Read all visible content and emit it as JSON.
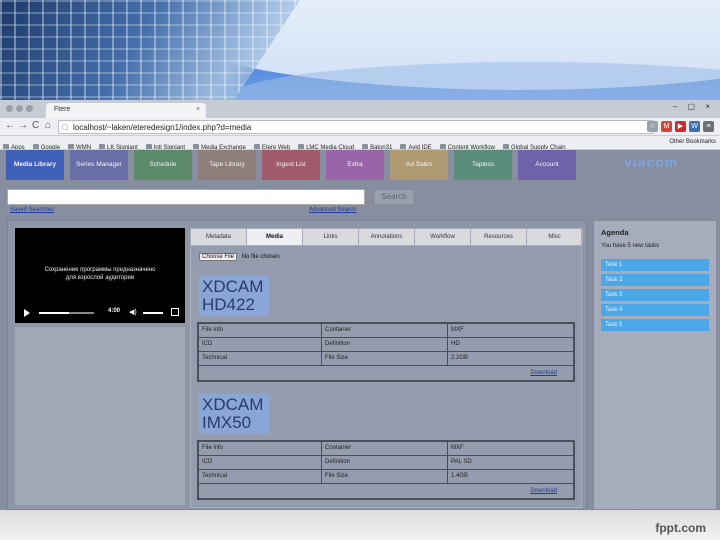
{
  "slide": {
    "brand": "fppt.com"
  },
  "browser": {
    "tab_title": "Ftere",
    "tab_close": "×",
    "window_controls": "– ▢ ×",
    "nav": {
      "back": "←",
      "forward": "→",
      "reload": "C",
      "home": "⌂"
    },
    "url": "localhost/~laken/eteredesign1/index.php?d=media",
    "extensions": [
      {
        "label": "☆",
        "color": "#9aa0aa"
      },
      {
        "label": "M",
        "color": "#d44638"
      },
      {
        "label": "▶",
        "color": "#cc2b2b"
      },
      {
        "label": "W",
        "color": "#3a6fb0"
      },
      {
        "label": "≡",
        "color": "#6b6f77"
      }
    ],
    "bookmarks": [
      "Apps",
      "Google",
      "WMN",
      "LK Signiant",
      "Intl Signiant",
      "Media Exchange",
      "Etere Web",
      "LMC Media Cloud",
      "Baton31",
      "Avid IDE",
      "Content Workflow",
      "Global Supply Chain"
    ],
    "other_bookmarks": "Other Bookmarks"
  },
  "app": {
    "nav_tabs": [
      {
        "label": "Media Library",
        "color": "#3f5fb8",
        "bold": true
      },
      {
        "label": "Series Manager",
        "color": "#6a6ea6"
      },
      {
        "label": "Schedule",
        "color": "#5e8a6c"
      },
      {
        "label": "Tape Library",
        "color": "#8e7f7a"
      },
      {
        "label": "Ingest List",
        "color": "#a05a6b"
      },
      {
        "label": "Extra",
        "color": "#9a64a8"
      },
      {
        "label": "Ad Sales",
        "color": "#b09a74"
      },
      {
        "label": "Tapless",
        "color": "#5c8c7c"
      },
      {
        "label": "Account",
        "color": "#6f62a8"
      }
    ],
    "logo": "viacom",
    "search": {
      "placeholder": "",
      "button": "Search"
    },
    "saved_searches": "Saved Searches",
    "advanced_search": "Advanced Search",
    "video": {
      "caption_line1": "Сохранение программы предназначено",
      "caption_line2": "для взрослой аудитории",
      "time": "4:00",
      "progress": 0.55
    },
    "detail_tabs": [
      "Metadata",
      "Media",
      "Links",
      "Annotations",
      "Workflow",
      "Resources",
      "Misc"
    ],
    "active_tab": "Media",
    "choose_file": {
      "button": "Choose File",
      "status": "No file chosen"
    },
    "formats": [
      {
        "title_line1": "XDCAM",
        "title_line2": "HD422",
        "rows": [
          [
            "File info",
            "Container",
            "MXF"
          ],
          [
            "ICD",
            "Definition",
            "HD"
          ],
          [
            "Technical",
            "File Size",
            "2.2GB"
          ]
        ],
        "download": "Download"
      },
      {
        "title_line1": "XDCAM",
        "title_line2": "IMX50",
        "rows": [
          [
            "File info",
            "Container",
            "MXF"
          ],
          [
            "ICD",
            "Definition",
            "PAL SD"
          ],
          [
            "Technical",
            "File Size",
            "1.4GB"
          ]
        ],
        "download": "Download"
      }
    ],
    "agenda": {
      "title": "Agenda",
      "subtitle": "You have 5 new tasks",
      "tasks": [
        "Task 1",
        "Task 2",
        "Task 3",
        "Task 4",
        "Task 5"
      ]
    }
  }
}
